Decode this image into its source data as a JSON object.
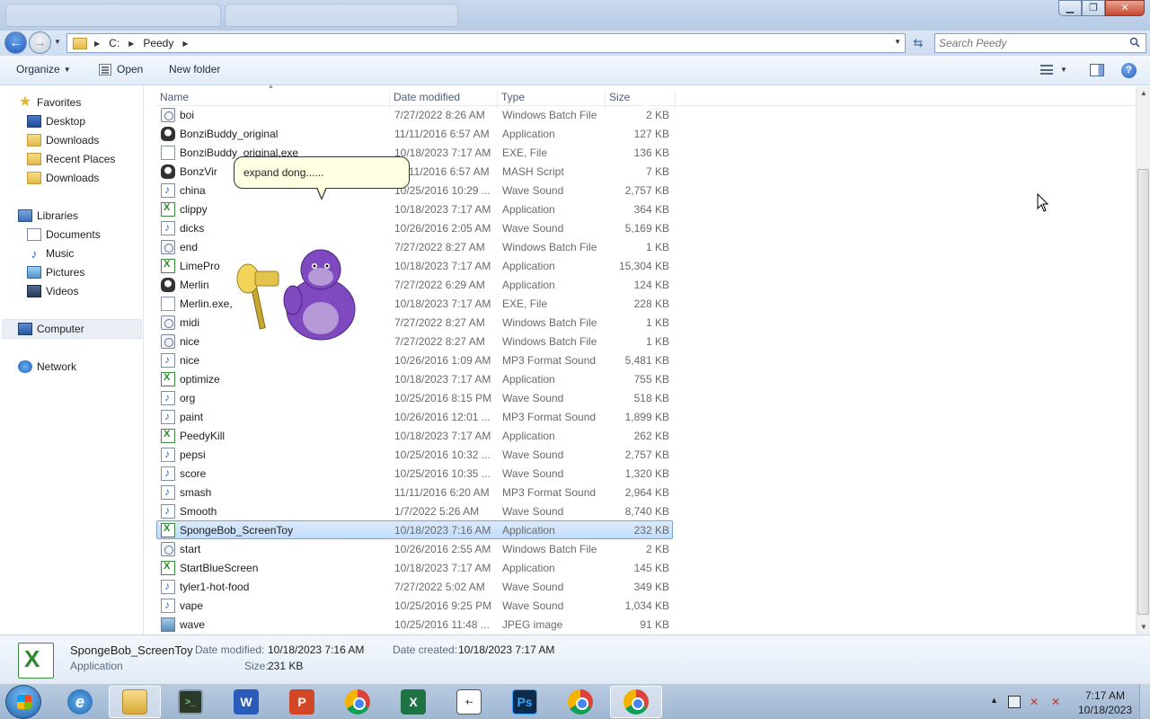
{
  "address": {
    "crumbs": [
      "C:",
      "Peedy"
    ],
    "search_placeholder": "Search Peedy"
  },
  "toolbar": {
    "organize": "Organize",
    "open": "Open",
    "new_folder": "New folder"
  },
  "nav": {
    "favorites": "Favorites",
    "desktop": "Desktop",
    "downloads1": "Downloads",
    "recent_places": "Recent Places",
    "downloads2": "Downloads",
    "libraries": "Libraries",
    "documents": "Documents",
    "music": "Music",
    "pictures": "Pictures",
    "videos": "Videos",
    "computer": "Computer",
    "network": "Network"
  },
  "columns": {
    "name": "Name",
    "date": "Date modified",
    "type": "Type",
    "size": "Size"
  },
  "files": [
    {
      "name": "boi",
      "date": "7/27/2022 8:26 AM",
      "type": "Windows Batch File",
      "size": "2 KB",
      "icon": "batch"
    },
    {
      "name": "BonziBuddy_original",
      "date": "11/11/2016 6:57 AM",
      "type": "Application",
      "size": "127 KB",
      "icon": "mash"
    },
    {
      "name": "BonziBuddy_original.exe",
      "date": "10/18/2023 7:17 AM",
      "type": "EXE, File",
      "size": "136 KB",
      "icon": "exefile"
    },
    {
      "name": "BonzVir",
      "date": "11/11/2016 6:57 AM",
      "type": "MASH Script",
      "size": "7 KB",
      "icon": "mash"
    },
    {
      "name": "china",
      "date": "10/25/2016 10:29 ...",
      "type": "Wave Sound",
      "size": "2,757 KB",
      "icon": "wave"
    },
    {
      "name": "clippy",
      "date": "10/18/2023 7:17 AM",
      "type": "Application",
      "size": "364 KB",
      "icon": "app"
    },
    {
      "name": "dicks",
      "date": "10/26/2016 2:05 AM",
      "type": "Wave Sound",
      "size": "5,169 KB",
      "icon": "wave"
    },
    {
      "name": "end",
      "date": "7/27/2022 8:27 AM",
      "type": "Windows Batch File",
      "size": "1 KB",
      "icon": "batch"
    },
    {
      "name": "LimePro",
      "date": "10/18/2023 7:17 AM",
      "type": "Application",
      "size": "15,304 KB",
      "icon": "app"
    },
    {
      "name": "Merlin",
      "date": "7/27/2022 6:29 AM",
      "type": "Application",
      "size": "124 KB",
      "icon": "mash"
    },
    {
      "name": "Merlin.exe,",
      "date": "10/18/2023 7:17 AM",
      "type": "EXE, File",
      "size": "228 KB",
      "icon": "exefile"
    },
    {
      "name": "midi",
      "date": "7/27/2022 8:27 AM",
      "type": "Windows Batch File",
      "size": "1 KB",
      "icon": "batch"
    },
    {
      "name": "nice",
      "date": "7/27/2022 8:27 AM",
      "type": "Windows Batch File",
      "size": "1 KB",
      "icon": "batch"
    },
    {
      "name": "nice",
      "date": "10/26/2016 1:09 AM",
      "type": "MP3 Format Sound",
      "size": "5,481 KB",
      "icon": "mp3"
    },
    {
      "name": "optimize",
      "date": "10/18/2023 7:17 AM",
      "type": "Application",
      "size": "755 KB",
      "icon": "app"
    },
    {
      "name": "org",
      "date": "10/25/2016 8:15 PM",
      "type": "Wave Sound",
      "size": "518 KB",
      "icon": "wave"
    },
    {
      "name": "paint",
      "date": "10/26/2016 12:01 ...",
      "type": "MP3 Format Sound",
      "size": "1,899 KB",
      "icon": "mp3"
    },
    {
      "name": "PeedyKill",
      "date": "10/18/2023 7:17 AM",
      "type": "Application",
      "size": "262 KB",
      "icon": "app"
    },
    {
      "name": "pepsi",
      "date": "10/25/2016 10:32 ...",
      "type": "Wave Sound",
      "size": "2,757 KB",
      "icon": "wave"
    },
    {
      "name": "score",
      "date": "10/25/2016 10:35 ...",
      "type": "Wave Sound",
      "size": "1,320 KB",
      "icon": "wave"
    },
    {
      "name": "smash",
      "date": "11/11/2016 6:20 AM",
      "type": "MP3 Format Sound",
      "size": "2,964 KB",
      "icon": "mp3"
    },
    {
      "name": "Smooth",
      "date": "1/7/2022 5:26 AM",
      "type": "Wave Sound",
      "size": "8,740 KB",
      "icon": "wave"
    },
    {
      "name": "SpongeBob_ScreenToy",
      "date": "10/18/2023 7:16 AM",
      "type": "Application",
      "size": "232 KB",
      "icon": "app",
      "selected": true
    },
    {
      "name": "start",
      "date": "10/26/2016 2:55 AM",
      "type": "Windows Batch File",
      "size": "2 KB",
      "icon": "batch"
    },
    {
      "name": "StartBlueScreen",
      "date": "10/18/2023 7:17 AM",
      "type": "Application",
      "size": "145 KB",
      "icon": "app"
    },
    {
      "name": "tyler1-hot-food",
      "date": "7/27/2022 5:02 AM",
      "type": "Wave Sound",
      "size": "349 KB",
      "icon": "wave"
    },
    {
      "name": "vape",
      "date": "10/25/2016 9:25 PM",
      "type": "Wave Sound",
      "size": "1,034 KB",
      "icon": "wave"
    },
    {
      "name": "wave",
      "date": "10/25/2016 11:48 ...",
      "type": "JPEG image",
      "size": "91 KB",
      "icon": "jpeg"
    }
  ],
  "agent": {
    "bubble_text": "expand dong......"
  },
  "details": {
    "name": "SpongeBob_ScreenToy",
    "kind": "Application",
    "date_modified_label": "Date modified:",
    "date_modified": "10/18/2023 7:16 AM",
    "date_created_label": "Date created:",
    "date_created": "10/18/2023 7:17 AM",
    "size_label": "Size:",
    "size": "231 KB"
  },
  "taskbar": {
    "apps": [
      "internet-explorer",
      "file-explorer",
      "terminal",
      "word",
      "powerpoint",
      "chrome",
      "excel",
      "calculator",
      "photoshop",
      "chrome",
      "chrome"
    ],
    "clock_time": "7:17 AM",
    "clock_date": "10/18/2023"
  },
  "colors": {
    "selection": "#c1dcfb",
    "accent": "#1b58b8"
  }
}
